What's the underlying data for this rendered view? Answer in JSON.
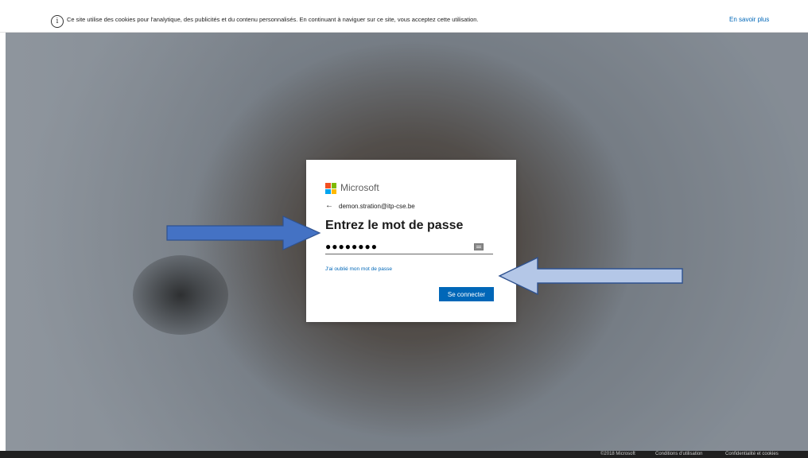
{
  "cookie_bar": {
    "text": "Ce site utilise des cookies pour l'analytique, des publicités et du contenu personnalisés. En continuant à naviguer sur ce site, vous acceptez cette utilisation.",
    "link": "En savoir plus"
  },
  "card": {
    "brand": "Microsoft",
    "identity": "demon.stration@itp-cse.be",
    "title": "Entrez le mot de passe",
    "password_value": "●●●●●●●●",
    "forgot_link": "J'ai oublié mon mot de passe",
    "submit_label": "Se connecter",
    "logo_colors": [
      "#f25022",
      "#7fba00",
      "#00a4ef",
      "#ffb900"
    ]
  },
  "footer": {
    "copyright": "©2018 Microsoft",
    "terms": "Conditions d'utilisation",
    "privacy": "Confidentialité et cookies"
  },
  "colors": {
    "accent": "#0067b8",
    "annotation_arrow": "#4472c4",
    "annotation_arrow_light": "#b4c7e7"
  },
  "icons": {
    "info": "info-circle-icon",
    "back": "back-arrow-icon",
    "keyboard": "keyboard-icon"
  }
}
